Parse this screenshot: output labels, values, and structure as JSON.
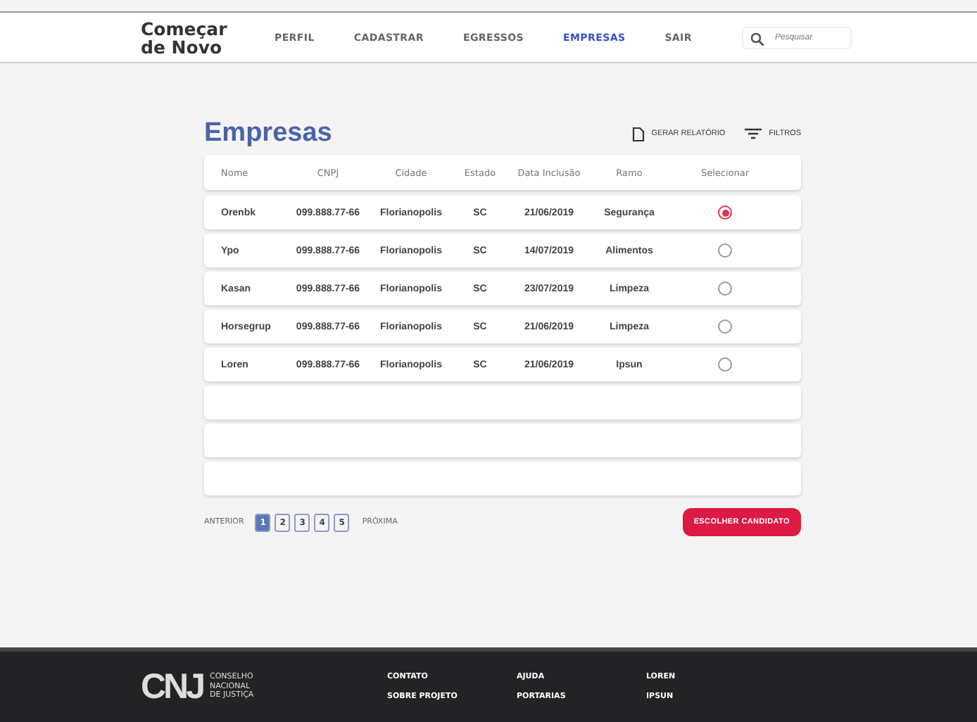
{
  "header": {
    "brand": [
      "Começar",
      "de Novo"
    ],
    "nav": [
      {
        "label": "PERFIL",
        "selected": false
      },
      {
        "label": "CADASTRAR",
        "selected": false
      },
      {
        "label": "EGRESSOS",
        "selected": false
      },
      {
        "label": "EMPRESAS",
        "selected": true
      },
      {
        "label": "SAIR",
        "selected": false
      }
    ],
    "search": {
      "placeholder": "Pesquisar"
    }
  },
  "page": {
    "title": "Empresas",
    "actions": [
      {
        "label": "GERAR RELATÓRIO",
        "kind": "document"
      },
      {
        "label": "FILTROS",
        "kind": "filter"
      }
    ]
  },
  "table": {
    "columns": [
      "Nome",
      "CNPJ",
      "Cidade",
      "Estado",
      "Data Inclusão",
      "Ramo",
      "Selecionar"
    ],
    "rows": [
      {
        "cells": [
          "Orenbk",
          "099.888.77-66",
          "Florianopolis",
          "SC",
          "21/06/2019",
          "Segurança"
        ],
        "selected": true
      },
      {
        "cells": [
          "Ypo",
          "099.888.77-66",
          "Florianopolis",
          "SC",
          "14/07/2019",
          "Alimentos"
        ],
        "selected": false
      },
      {
        "cells": [
          "Kasan",
          "099.888.77-66",
          "Florianopolis",
          "SC",
          "23/07/2019",
          "Limpeza"
        ],
        "selected": false
      },
      {
        "cells": [
          "Horsegrup",
          "099.888.77-66",
          "Florianopolis",
          "SC",
          "21/06/2019",
          "Limpeza"
        ],
        "selected": false
      },
      {
        "cells": [
          "Loren",
          "099.888.77-66",
          "Florianopolis",
          "SC",
          "21/06/2019",
          "Ipsun"
        ],
        "selected": false
      }
    ]
  },
  "pagination": {
    "previous": "ANTERIOR",
    "pages": [
      {
        "label": "1",
        "selected": true
      },
      {
        "label": "2",
        "selected": false
      },
      {
        "label": "3",
        "selected": false
      },
      {
        "label": "4",
        "selected": false
      },
      {
        "label": "5",
        "selected": false
      }
    ],
    "next": "PRÓXIMA"
  },
  "primary_button": "ESCOLHER CANDIDATO",
  "footer": {
    "logo_mark": "CNJ",
    "logo_text": [
      "CONSELHO",
      "NACIONAL",
      "DE JUSTIÇA"
    ],
    "links": [
      [
        "CONTATO",
        "SOBRE PROJETO"
      ],
      [
        "AJUDA",
        "PORTARIAS"
      ],
      [
        "LOREN",
        "IPSUN"
      ]
    ]
  }
}
